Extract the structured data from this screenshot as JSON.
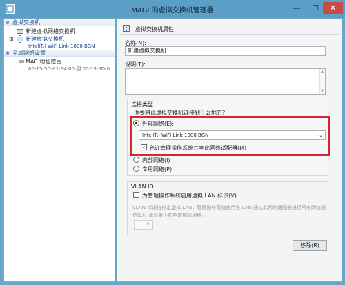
{
  "window": {
    "title": "MAGI 的虚拟交换机管理器"
  },
  "sidebar": {
    "section_switches": "虚拟交换机",
    "items": [
      {
        "label": "新建虚拟网络交换机"
      },
      {
        "label": "新建虚拟交换机",
        "sub": "Intel(R) WiFi Link 1000 BGN"
      }
    ],
    "section_global": "全局网络设置",
    "mac": {
      "label": "MAC 地址范围",
      "sub": "00-15-5D-01-64-00 到 00-15-5D-0..."
    }
  },
  "panel": {
    "header": "虚拟交换机属性",
    "name_label": "名称(N):",
    "name_value": "新建虚拟交换机",
    "notes_label": "说明(T):",
    "connection": {
      "title": "连接类型",
      "question": "你要将此虚拟交换机连接到什么地方?",
      "external": "外部网络(E):",
      "adapter": "Intel(R) WiFi Link 1000 BGN",
      "allow_mgmt": "允许管理操作系统共享此网络适配器(M)",
      "internal": "内部网络(I)",
      "private": "专用网络(P)"
    },
    "vlan": {
      "title": "VLAN ID",
      "enable": "为管理操作系统启用虚拟 LAN 标识(V)",
      "desc": "VLAN 标识符指定虚拟 LAN，管理操作系统使用该 LAN 通过此网络适配器进行所有网络通信(L)。此设置不影响虚拟机网络。",
      "value": "2"
    },
    "remove_button": "移除(R)"
  }
}
